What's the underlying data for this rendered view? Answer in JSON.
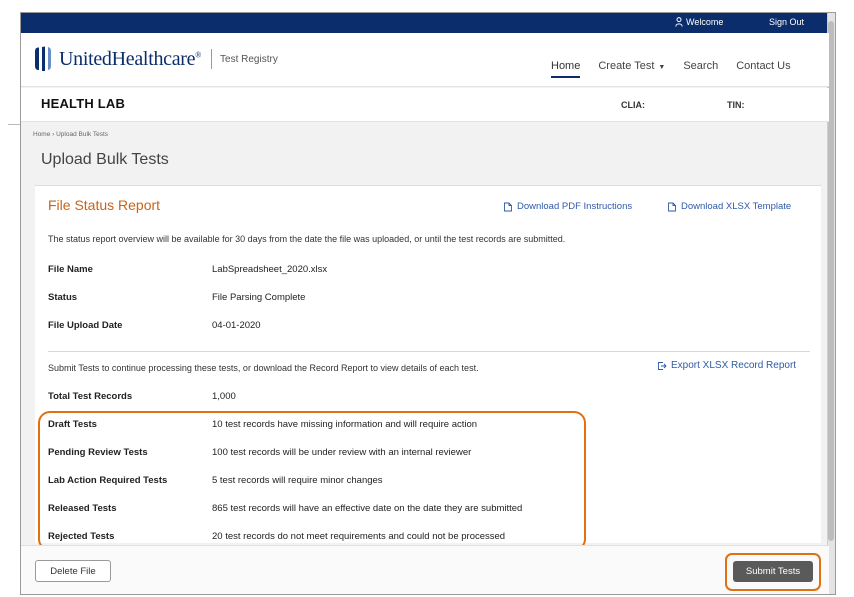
{
  "topbar": {
    "welcome": "Welcome",
    "signout": "Sign Out"
  },
  "header": {
    "brand": "UnitedHealthcare",
    "trademark": "®",
    "registry": "Test Registry",
    "nav": [
      {
        "label": "Home",
        "active": true
      },
      {
        "label": "Create Test",
        "caret": "▼"
      },
      {
        "label": "Search"
      },
      {
        "label": "Contact Us"
      }
    ]
  },
  "lab": {
    "name": "HEALTH LAB",
    "clia_label": "CLIA:",
    "tin_label": "TIN:"
  },
  "breadcrumb": "Home › Upload Bulk Tests",
  "page_title": "Upload Bulk Tests",
  "report": {
    "title": "File Status Report",
    "download_pdf": "Download PDF Instructions",
    "download_xlsx": "Download XLSX Template",
    "notice": "The status report overview will be available for 30 days from the date the file was uploaded, or until the test records are submitted.",
    "file_info": [
      {
        "label": "File Name",
        "value": "LabSpreadsheet_2020.xlsx"
      },
      {
        "label": "Status",
        "value": "File Parsing Complete"
      },
      {
        "label": "File Upload Date",
        "value": "04-01-2020"
      }
    ],
    "submit_note": "Submit Tests to continue processing these tests, or download the Record Report to view details of each test.",
    "export_label": "Export XLSX Record Report",
    "total": {
      "label": "Total Test Records",
      "value": "1,000"
    },
    "categories": [
      {
        "label": "Draft Tests",
        "value": "10 test records have missing information and will require action"
      },
      {
        "label": "Pending Review Tests",
        "value": "100 test records will be under review with an internal reviewer"
      },
      {
        "label": "Lab Action Required Tests",
        "value": "5 test records will require minor changes"
      },
      {
        "label": "Released Tests",
        "value": "865 test records will have an effective date on the date they are submitted"
      },
      {
        "label": "Rejected Tests",
        "value": "20 test records do not meet requirements and could not be processed"
      }
    ]
  },
  "footer": {
    "delete_label": "Delete File",
    "submit_label": "Submit Tests"
  },
  "colors": {
    "navy": "#0b2d6b",
    "accent_orange": "#e07012",
    "title_orange": "#c8641a",
    "link_blue": "#2e5aa8"
  },
  "icons": [
    "user-icon",
    "document-icon",
    "export-icon"
  ]
}
